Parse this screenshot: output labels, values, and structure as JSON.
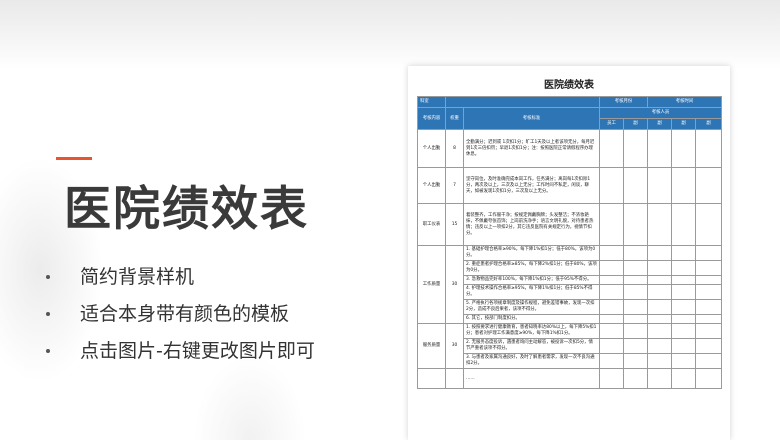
{
  "slide": {
    "title": "医院绩效表",
    "bullets": [
      "简约背景样机",
      "适合本身带有颜色的模板",
      "点击图片-右键更改图片即可"
    ],
    "accent_color": "#e8542f",
    "title_color": "#3a3a3a"
  },
  "document": {
    "title": "医院绩效表",
    "header_color": "#2e75b6",
    "row1": {
      "dept_label": "科室",
      "month_label": "考核月份",
      "time_label": "考核时间"
    },
    "row2": {
      "content_label": "考核内容",
      "weight_label": "权重",
      "standard_label": "考核标准",
      "person_label": "考核人员",
      "cols": [
        "员工",
        "副",
        "副",
        "副",
        "副"
      ]
    },
    "rows": [
      {
        "category": "个人出勤",
        "weight": "8",
        "standard": "全勤满分；迟到或 1次扣1分；旷工1天及以上者该项无分，每月迟到1次三倍扣罚；早退1次扣1分；注：按照医院正常请假程序办理休息。"
      },
      {
        "category": "个人出勤",
        "weight": "7",
        "standard": "坚守岗位，及时准确完成本岗工作，任务满分；离岗每1次扣除1分，两次及以上，三次及以上无分；工作时间不私定，闲谈，聊天，如被发现1次扣1分，三次及以上无分。"
      },
      {
        "category": "职工仪表",
        "weight": "15",
        "standard": "着装整齐，工作服干净；按规定佩戴胸牌；头发整洁；不浓妆艳抹，不佩戴夸张首饰；上岗前洗净手；语言文明礼貌，对待患者热情；违反以上一项扣2分，其它违反医院有关规定行为，视情节扣分。"
      },
      {
        "category": "工作质量",
        "weight": "30",
        "items": [
          "1. 基础护理合格率≥90%，每下降1%扣1分；低于80%，该项为0分。",
          "2. 重症患者护理合格率≥85%，每下降2%扣1分；低于80%，该项为0分。",
          "3. 急救物品完好率100%，每下降1%扣1分；低于95%不得分。",
          "4. 护理技术操作合格率≥95%，每下降1%扣1分；低于85%不得分。",
          "5. 严格执行各项规章制度及操作规程，避免差错事故，发现一次扣2分，造成不良后果者，该项不得分。",
          "6. 其它，按部门制度扣分。"
        ]
      },
      {
        "category": "服务质量",
        "weight": "30",
        "items": [
          "1. 按照要求进行健康教育，患者知晓率达80%以上，每下降5%扣1分；患者对护理工作满意度≥90%，每下降1%扣1分。",
          "2. 无服务态度投诉，遇患者询问主动解答，被投诉一次扣5分，情节严重者该项不得分。",
          "3. 与患者及家属沟通良好，及时了解患者需求，发现一次不良沟通扣2分。"
        ]
      },
      {
        "category": "",
        "weight": "",
        "standard": "……"
      }
    ]
  }
}
